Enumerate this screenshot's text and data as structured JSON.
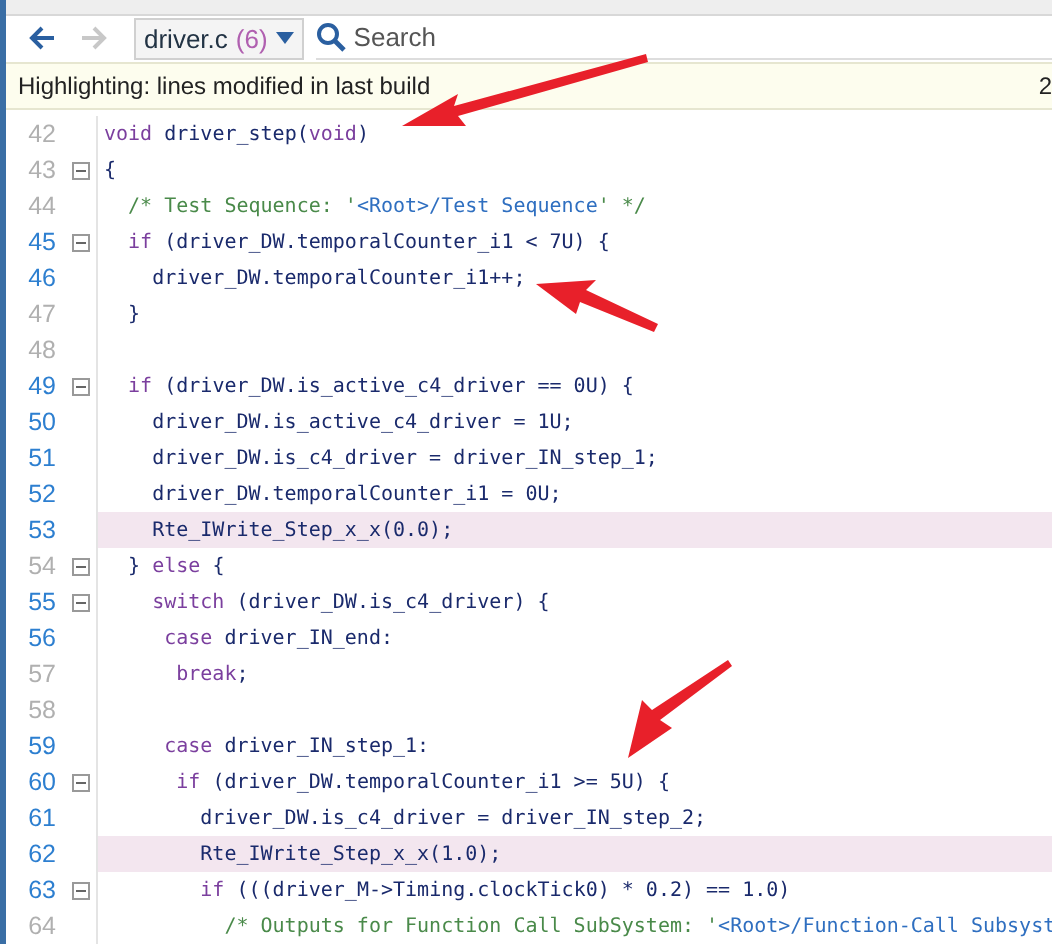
{
  "toolbar": {
    "back": {
      "disabled": false
    },
    "forward": {
      "disabled": true
    },
    "file": {
      "name": "driver.c",
      "count": "(6)"
    },
    "search": {
      "placeholder": "Search"
    }
  },
  "info_bar": {
    "text": "Highlighting: lines modified in last build",
    "right_text": "2"
  },
  "lines": [
    {
      "number": "42",
      "linked": false,
      "highlighted": false,
      "foldable": false,
      "parts": [
        {
          "kind": "kw",
          "text": "void"
        },
        {
          "kind": "plain",
          "text": " driver_step("
        },
        {
          "kind": "kw",
          "text": "void"
        },
        {
          "kind": "plain",
          "text": ")"
        }
      ]
    },
    {
      "number": "43",
      "linked": false,
      "highlighted": false,
      "foldable": true,
      "parts": [
        {
          "kind": "plain",
          "text": "{"
        }
      ]
    },
    {
      "number": "44",
      "linked": false,
      "highlighted": false,
      "foldable": false,
      "parts": [
        {
          "kind": "comment",
          "text": "  /* Test Sequence: '"
        },
        {
          "kind": "string",
          "text": "<Root>/Test Sequence"
        },
        {
          "kind": "comment",
          "text": "' */"
        }
      ]
    },
    {
      "number": "45",
      "linked": true,
      "highlighted": false,
      "foldable": true,
      "parts": [
        {
          "kind": "kw",
          "text": "  if"
        },
        {
          "kind": "plain",
          "text": " (driver_DW.temporalCounter_i1 < 7U) {"
        }
      ]
    },
    {
      "number": "46",
      "linked": true,
      "highlighted": false,
      "foldable": false,
      "parts": [
        {
          "kind": "plain",
          "text": "    driver_DW.temporalCounter_i1++;"
        }
      ]
    },
    {
      "number": "47",
      "linked": false,
      "highlighted": false,
      "foldable": false,
      "parts": [
        {
          "kind": "plain",
          "text": "  }"
        }
      ]
    },
    {
      "number": "48",
      "linked": false,
      "highlighted": false,
      "foldable": false
    },
    {
      "number": "49",
      "linked": true,
      "highlighted": false,
      "foldable": true,
      "parts": [
        {
          "kind": "kw",
          "text": "  if"
        },
        {
          "kind": "plain",
          "text": " (driver_DW.is_active_c4_driver == 0U) {"
        }
      ]
    },
    {
      "number": "50",
      "linked": true,
      "highlighted": false,
      "foldable": false,
      "parts": [
        {
          "kind": "plain",
          "text": "    driver_DW.is_active_c4_driver = 1U;"
        }
      ]
    },
    {
      "number": "51",
      "linked": true,
      "highlighted": false,
      "foldable": false,
      "parts": [
        {
          "kind": "plain",
          "text": "    driver_DW.is_c4_driver = driver_IN_step_1;"
        }
      ]
    },
    {
      "number": "52",
      "linked": true,
      "highlighted": false,
      "foldable": false,
      "parts": [
        {
          "kind": "plain",
          "text": "    driver_DW.temporalCounter_i1 = 0U;"
        }
      ]
    },
    {
      "number": "53",
      "linked": true,
      "highlighted": true,
      "foldable": false,
      "parts": [
        {
          "kind": "plain",
          "text": "    Rte_IWrite_Step_x_x(0.0);"
        }
      ]
    },
    {
      "number": "54",
      "linked": false,
      "highlighted": false,
      "foldable": true,
      "parts": [
        {
          "kind": "plain",
          "text": "  } "
        },
        {
          "kind": "kw",
          "text": "else"
        },
        {
          "kind": "plain",
          "text": " {"
        }
      ]
    },
    {
      "number": "55",
      "linked": true,
      "highlighted": false,
      "foldable": true,
      "parts": [
        {
          "kind": "kw",
          "text": "    switch"
        },
        {
          "kind": "plain",
          "text": " (driver_DW.is_c4_driver) {"
        }
      ]
    },
    {
      "number": "56",
      "linked": true,
      "highlighted": false,
      "foldable": false,
      "parts": [
        {
          "kind": "kw",
          "text": "     case"
        },
        {
          "kind": "plain",
          "text": " driver_IN_end:"
        }
      ]
    },
    {
      "number": "57",
      "linked": false,
      "highlighted": false,
      "foldable": false,
      "parts": [
        {
          "kind": "kw",
          "text": "      break"
        },
        {
          "kind": "plain",
          "text": ";"
        }
      ]
    },
    {
      "number": "58",
      "linked": false,
      "highlighted": false,
      "foldable": false
    },
    {
      "number": "59",
      "linked": true,
      "highlighted": false,
      "foldable": false,
      "parts": [
        {
          "kind": "kw",
          "text": "     case"
        },
        {
          "kind": "plain",
          "text": " driver_IN_step_1:"
        }
      ]
    },
    {
      "number": "60",
      "linked": true,
      "highlighted": false,
      "foldable": true,
      "parts": [
        {
          "kind": "kw",
          "text": "      if"
        },
        {
          "kind": "plain",
          "text": " (driver_DW.temporalCounter_i1 >= 5U) {"
        }
      ]
    },
    {
      "number": "61",
      "linked": true,
      "highlighted": false,
      "foldable": false,
      "parts": [
        {
          "kind": "plain",
          "text": "        driver_DW.is_c4_driver = driver_IN_step_2;"
        }
      ]
    },
    {
      "number": "62",
      "linked": true,
      "highlighted": true,
      "foldable": false,
      "parts": [
        {
          "kind": "plain",
          "text": "        Rte_IWrite_Step_x_x(1.0);"
        }
      ]
    },
    {
      "number": "63",
      "linked": true,
      "highlighted": false,
      "foldable": true,
      "parts": [
        {
          "kind": "kw",
          "text": "        if"
        },
        {
          "kind": "plain",
          "text": " (((driver_M->Timing.clockTick0) * 0.2) == 1.0)"
        }
      ]
    },
    {
      "number": "64",
      "linked": false,
      "highlighted": false,
      "foldable": false,
      "parts": [
        {
          "kind": "comment",
          "text": "          /* Outputs for Function Call SubSystem: '"
        },
        {
          "kind": "string",
          "text": "<Root>/Function-Call Subsyst"
        }
      ]
    }
  ]
}
